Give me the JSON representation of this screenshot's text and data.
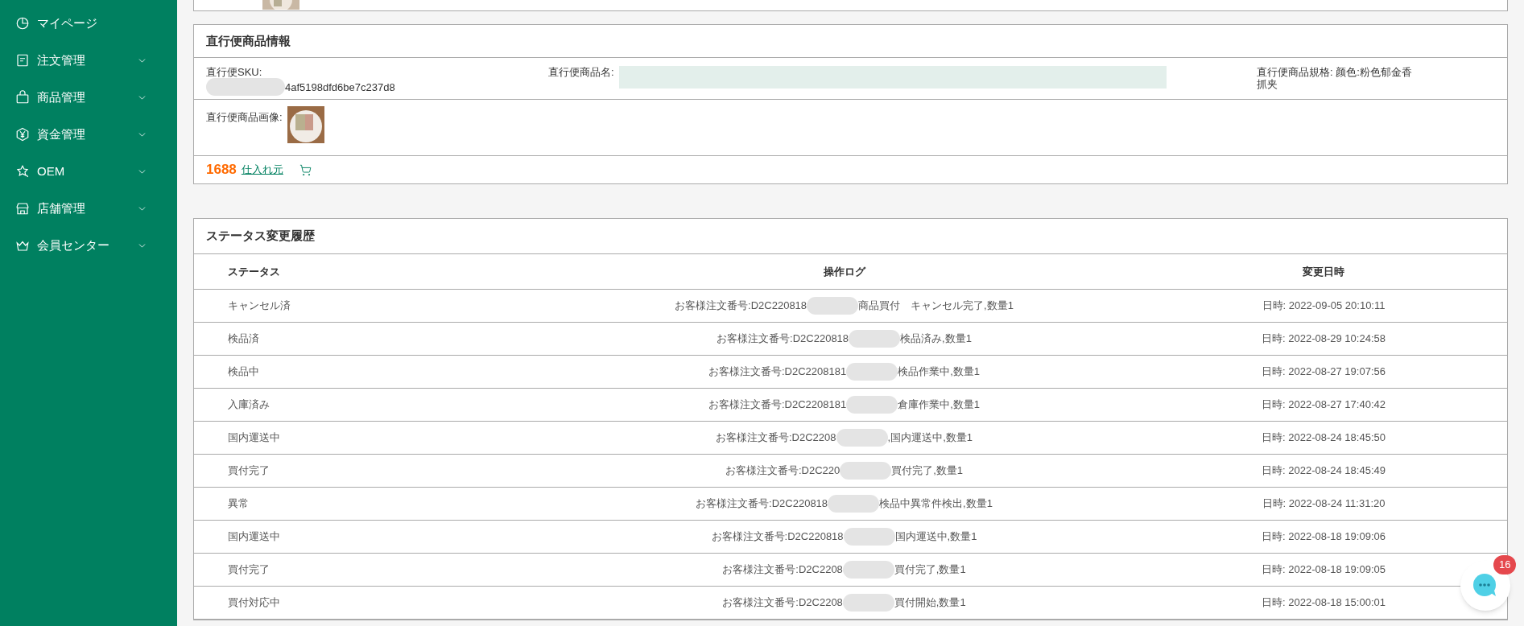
{
  "sidebar": {
    "items": [
      {
        "label": "マイページ",
        "expandable": false
      },
      {
        "label": "注文管理",
        "expandable": true
      },
      {
        "label": "商品管理",
        "expandable": true
      },
      {
        "label": "資金管理",
        "expandable": true
      },
      {
        "label": "OEM",
        "expandable": true
      },
      {
        "label": "店舗管理",
        "expandable": true
      },
      {
        "label": "会員センター",
        "expandable": true
      }
    ]
  },
  "product": {
    "title": "直行便商品情報",
    "sku_label": "直行便SKU:",
    "sku_value": "4af5198dfd6be7c237d8",
    "name_label": "直行便商品名:",
    "spec": "直行便商品規格: 颜色:粉色郁金香抓夹",
    "image_label": "直行便商品画像:",
    "source_brand": "1688",
    "source_link": "仕入れ元"
  },
  "history": {
    "title": "ステータス変更履歴",
    "columns": [
      "ステータス",
      "操作ログ",
      "変更日時"
    ],
    "rows": [
      {
        "status": "キャンセル済",
        "log_before": "お客様注文番号:D2C220818",
        "log_after": "商品買付　キャンセル完了,数量1",
        "date": "日時: 2022-09-05 20:10:11"
      },
      {
        "status": "検品済",
        "log_before": "お客様注文番号:D2C220818",
        "log_after": "検品済み,数量1",
        "date": "日時: 2022-08-29 10:24:58"
      },
      {
        "status": "検品中",
        "log_before": "お客様注文番号:D2C2208181",
        "log_after": "検品作業中,数量1",
        "date": "日時: 2022-08-27 19:07:56"
      },
      {
        "status": "入庫済み",
        "log_before": "お客様注文番号:D2C2208181",
        "log_after": "倉庫作業中,数量1",
        "date": "日時: 2022-08-27 17:40:42"
      },
      {
        "status": "国内運送中",
        "log_before": "お客様注文番号:D2C2208",
        "log_after": ",国内運送中,数量1",
        "date": "日時: 2022-08-24 18:45:50"
      },
      {
        "status": "買付完了",
        "log_before": "お客様注文番号:D2C220",
        "log_after": "買付完了,数量1",
        "date": "日時: 2022-08-24 18:45:49"
      },
      {
        "status": "異常",
        "log_before": "お客様注文番号:D2C220818",
        "log_after": "検品中異常件検出,数量1",
        "date": "日時: 2022-08-24 11:31:20"
      },
      {
        "status": "国内運送中",
        "log_before": "お客様注文番号:D2C220818",
        "log_after": "国内運送中,数量1",
        "date": "日時: 2022-08-18 19:09:06"
      },
      {
        "status": "買付完了",
        "log_before": "お客様注文番号:D2C2208",
        "log_after": "買付完了,数量1",
        "date": "日時: 2022-08-18 19:09:05"
      },
      {
        "status": "買付対応中",
        "log_before": "お客様注文番号:D2C2208",
        "log_after": "買付開始,数量1",
        "date": "日時: 2022-08-18 15:00:01"
      }
    ]
  },
  "chat": {
    "badge": "16"
  }
}
